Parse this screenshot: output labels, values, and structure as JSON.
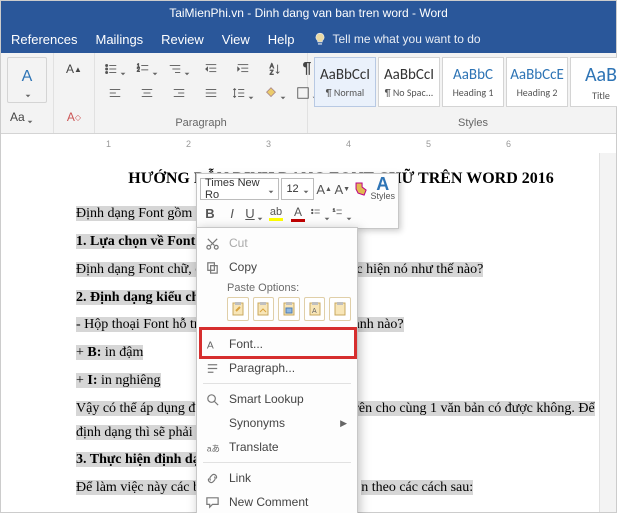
{
  "title": "TaiMienPhi.vn - Dinh dang van ban tren word  -  Word",
  "menu": {
    "references": "References",
    "mailings": "Mailings",
    "review": "Review",
    "view": "View",
    "help": "Help",
    "tellme": "Tell me what you want to do"
  },
  "ribbon": {
    "paragraph_label": "Paragraph",
    "styles_label": "Styles",
    "styles": [
      {
        "sample": "AaBbCcI",
        "name": "¶ Normal"
      },
      {
        "sample": "AaBbCcI",
        "name": "¶ No Spac..."
      },
      {
        "sample": "AaBbC",
        "name": "Heading 1",
        "blue": true
      },
      {
        "sample": "AaBbCcE",
        "name": "Heading 2",
        "blue": true
      },
      {
        "sample": "AaB",
        "name": "Title",
        "blue": true,
        "big": true
      }
    ]
  },
  "ruler_marks": [
    "1",
    "2",
    "3",
    "4",
    "5",
    "6"
  ],
  "doc": {
    "title": "HƯỚNG DẪN ĐỊNH DẠNG FONT CHỮ TRÊN WORD 2016",
    "p1": "Định dạng Font gồm c",
    "p2a": "1. Lựa chọn về Font c",
    "p3a": "Định dạng Font chữ, c",
    "p3b": "c hiện nó như thế nào?",
    "p4": "2. Định dạng kiểu ch",
    "p5a": "- Hộp thoại Font hỗ tr",
    "p5b": "ành nào?",
    "p6a": "+ ",
    "p6b": "B:",
    "p6c": " in đậm",
    "p7a": "+ ",
    "p7b": "I:",
    "p7c": " in nghiêng",
    "p8a": "Vậy có thể áp dụng đ",
    "p8b": "trên cho cùng 1 văn bản có được không. Để định dạng thì sẽ phải t",
    "p9": "3. Thực hiện định dạ",
    "p10a": "Để làm việc này các bạ",
    "p10b": "n theo các cách sau:"
  },
  "mini": {
    "font": "Times New Ro",
    "size": "12",
    "styles_label": "Styles"
  },
  "ctx": {
    "cut": "Cut",
    "copy": "Copy",
    "paste_header": "Paste Options:",
    "font": "Font...",
    "paragraph": "Paragraph...",
    "smart": "Smart Lookup",
    "synonyms": "Synonyms",
    "translate": "Translate",
    "link": "Link",
    "comment": "New Comment"
  }
}
